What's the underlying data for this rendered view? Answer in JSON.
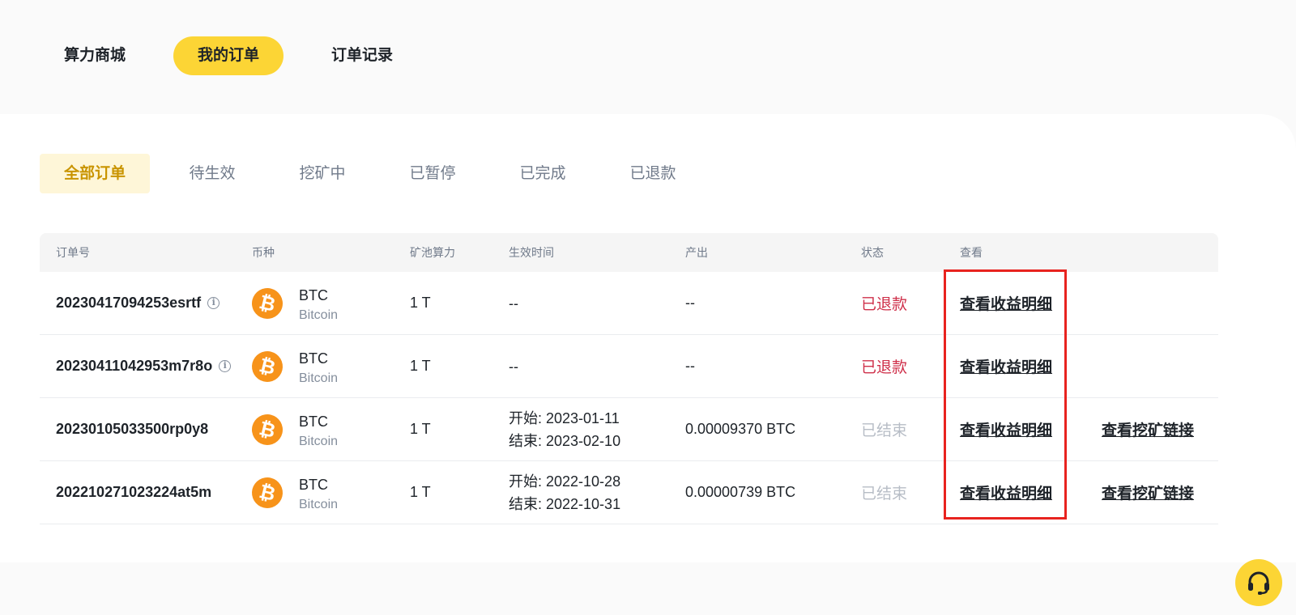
{
  "top_tabs": [
    "算力商城",
    "我的订单",
    "订单记录"
  ],
  "sub_tabs": [
    "全部订单",
    "待生效",
    "挖矿中",
    "已暂停",
    "已完成",
    "已退款"
  ],
  "table": {
    "headers": [
      "订单号",
      "币种",
      "矿池算力",
      "生效时间",
      "产出",
      "状态",
      "查看"
    ],
    "rows": [
      {
        "order_id": "20230417094253esrtf",
        "has_info": true,
        "coin_symbol": "BTC",
        "coin_name": "Bitcoin",
        "power": "1 T",
        "time_line1": "--",
        "time_line2": "",
        "output": "--",
        "status": "已退款",
        "view_label": "查看收益明细",
        "link_label": ""
      },
      {
        "order_id": "20230411042953m7r8o",
        "has_info": true,
        "coin_symbol": "BTC",
        "coin_name": "Bitcoin",
        "power": "1 T",
        "time_line1": "--",
        "time_line2": "",
        "output": "--",
        "status": "已退款",
        "view_label": "查看收益明细",
        "link_label": ""
      },
      {
        "order_id": "20230105033500rp0y8",
        "has_info": false,
        "coin_symbol": "BTC",
        "coin_name": "Bitcoin",
        "power": "1 T",
        "time_line1": "开始: 2023-01-11",
        "time_line2": "结束: 2023-02-10",
        "output": "0.00009370 BTC",
        "status": "已结束",
        "view_label": "查看收益明细",
        "link_label": "查看挖矿链接"
      },
      {
        "order_id": "202210271023224at5m",
        "has_info": false,
        "coin_symbol": "BTC",
        "coin_name": "Bitcoin",
        "power": "1 T",
        "time_line1": "开始: 2022-10-28",
        "time_line2": "结束: 2022-10-31",
        "output": "0.00000739 BTC",
        "status": "已结束",
        "view_label": "查看收益明细",
        "link_label": "查看挖矿链接"
      }
    ]
  },
  "icons": {
    "info": "info-icon",
    "coin": "bitcoin-icon",
    "support": "headset-icon"
  },
  "colors": {
    "accent": "#fcd535",
    "active_subtab_text": "#c99400",
    "refund_status": "#cf304a",
    "ended_status": "#b7bdc6",
    "highlight_box": "#e8231f"
  }
}
